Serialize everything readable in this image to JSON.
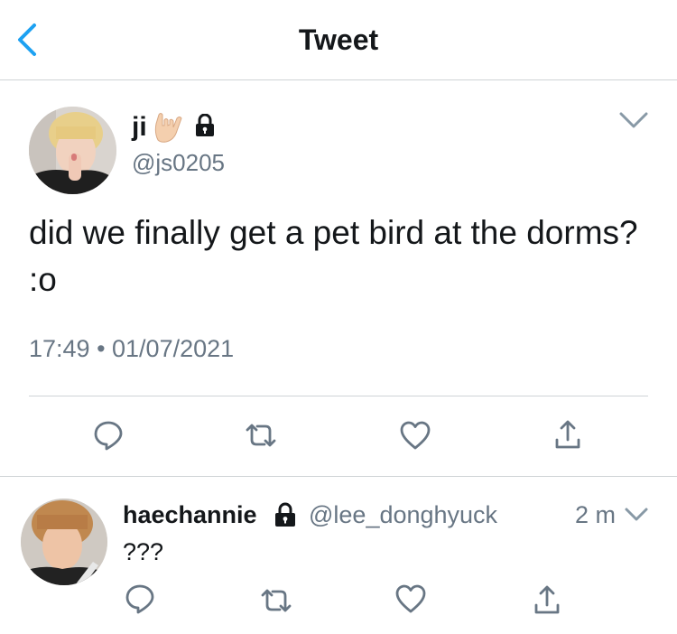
{
  "header": {
    "title": "Tweet",
    "back_icon": "chevron-left-icon",
    "accent": "#1da1f2"
  },
  "tweet": {
    "display_name": "ji",
    "name_emoji": "🤟🏻",
    "protected_icon": "lock-icon",
    "handle": "@js0205",
    "text": "did we finally get a pet bird at the dorms? :o",
    "timestamp": "17:49 • 01/07/2021",
    "actions": [
      "reply-icon",
      "retweet-icon",
      "like-icon",
      "share-icon"
    ]
  },
  "reply": {
    "display_name": "haechannie",
    "protected_icon": "lock-icon",
    "handle": "@lee_donghyuck",
    "time": "2 m",
    "text": "???",
    "actions": [
      "reply-icon",
      "retweet-icon",
      "like-icon",
      "share-icon"
    ]
  },
  "colors": {
    "text": "#14171a",
    "secondary": "#687684",
    "divider": "#cfd3d6",
    "accent": "#1da1f2"
  }
}
